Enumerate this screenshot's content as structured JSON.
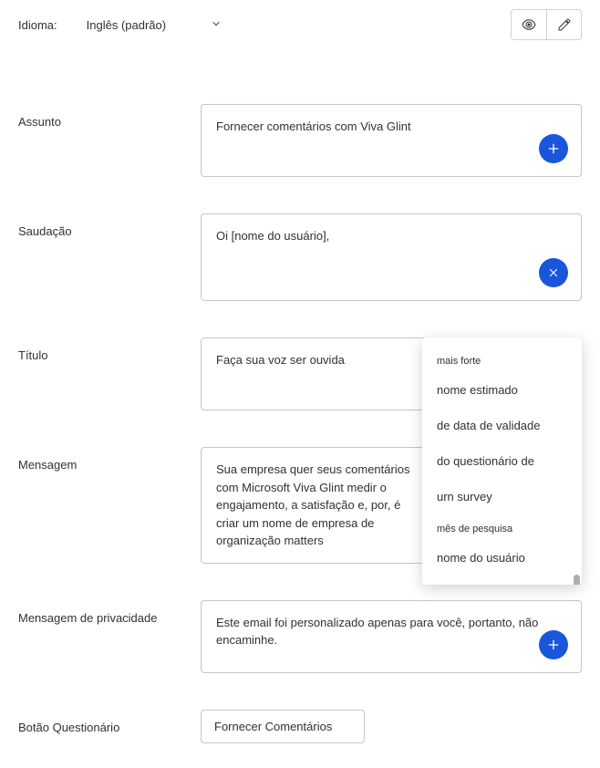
{
  "top": {
    "language_label": "Idioma:",
    "language_value": "Inglês (padrão)"
  },
  "fields": {
    "subject": {
      "label": "Assunto",
      "value": "Fornecer comentários com Viva Glint"
    },
    "greeting": {
      "label": "Saudação",
      "value": "Oi [nome do usuário],"
    },
    "title": {
      "label": "Título",
      "value": "Faça sua voz ser ouvida"
    },
    "message": {
      "label": "Mensagem",
      "value": "Sua empresa quer seus comentários com   Microsoft Viva Glint medir o engajamento, a satisfação e, por, é criar um nome de empresa de organização matters"
    },
    "privacy": {
      "label": "Mensagem de privacidade",
      "value": "Este email foi personalizado apenas para você, portanto, não encaminhe."
    },
    "button": {
      "label": "Botão Questionário",
      "value": "Fornecer Comentários"
    }
  },
  "dropdown": {
    "items": [
      {
        "text": "mais forte",
        "cls": "small"
      },
      {
        "text": "nome estimado",
        "cls": ""
      },
      {
        "text": "de data de validade",
        "cls": ""
      },
      {
        "text": "do questionário de",
        "cls": ""
      },
      {
        "text": "urn survey",
        "cls": ""
      },
      {
        "text": "mês de pesquisa",
        "cls": "small"
      },
      {
        "text": "nome do usuário",
        "cls": ""
      }
    ]
  }
}
